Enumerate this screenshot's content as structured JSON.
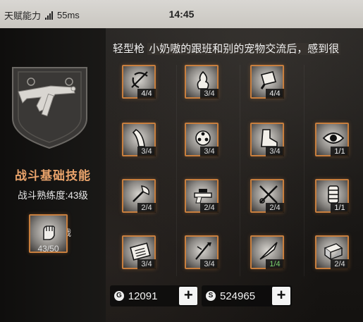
{
  "status_bar": {
    "carrier": "天赋能力",
    "latency": "55ms",
    "time": "14:45"
  },
  "weapon_panel": {
    "skill_title": "战斗基础技能",
    "skill_level": "战斗熟练度:43级",
    "featured_skill": {
      "name": "骁勇善战",
      "progress": "43/50",
      "icon": "fist-icon"
    }
  },
  "header": {
    "prefix": "轻型枪",
    "message": "小奶嗷的跟班和别的宠物交流后，感到很"
  },
  "skills": [
    {
      "icon": "crossbow-icon",
      "progress": "4/4",
      "state": "full"
    },
    {
      "icon": "flame-icon",
      "progress": "3/4",
      "state": "partial"
    },
    {
      "icon": "cleaver-icon",
      "progress": "4/4",
      "state": "full"
    },
    {
      "icon": "magazine-icon",
      "progress": "3/4",
      "state": "partial"
    },
    {
      "icon": "revolver-icon",
      "progress": "3/4",
      "state": "partial"
    },
    {
      "icon": "boot-icon",
      "progress": "3/4",
      "state": "partial"
    },
    {
      "icon": "eye-icon",
      "progress": "1/1",
      "state": "full"
    },
    {
      "icon": "axe-icon",
      "progress": "2/4",
      "state": "partial"
    },
    {
      "icon": "scope-gun-icon",
      "progress": "2/4",
      "state": "partial"
    },
    {
      "icon": "shears-icon",
      "progress": "2/4",
      "state": "partial"
    },
    {
      "icon": "barrel-icon",
      "progress": "1/1",
      "state": "full"
    },
    {
      "icon": "keypad-icon",
      "progress": "3/4",
      "state": "partial"
    },
    {
      "icon": "spear-icon",
      "progress": "3/4",
      "state": "partial"
    },
    {
      "icon": "knife-icon",
      "progress": "1/4",
      "state": "low"
    },
    {
      "icon": "ammo-box-icon",
      "progress": "2/4",
      "state": "partial"
    }
  ],
  "currency": {
    "gold": {
      "icon": "gold-coin-icon",
      "symbol": "G",
      "amount": "12091",
      "add": "+"
    },
    "silver": {
      "icon": "silver-coin-icon",
      "symbol": "S",
      "amount": "524965",
      "add": "+"
    }
  },
  "colors": {
    "accent": "#c97f3e",
    "title": "#e9a36b",
    "low_progress": "#7cd36d"
  }
}
